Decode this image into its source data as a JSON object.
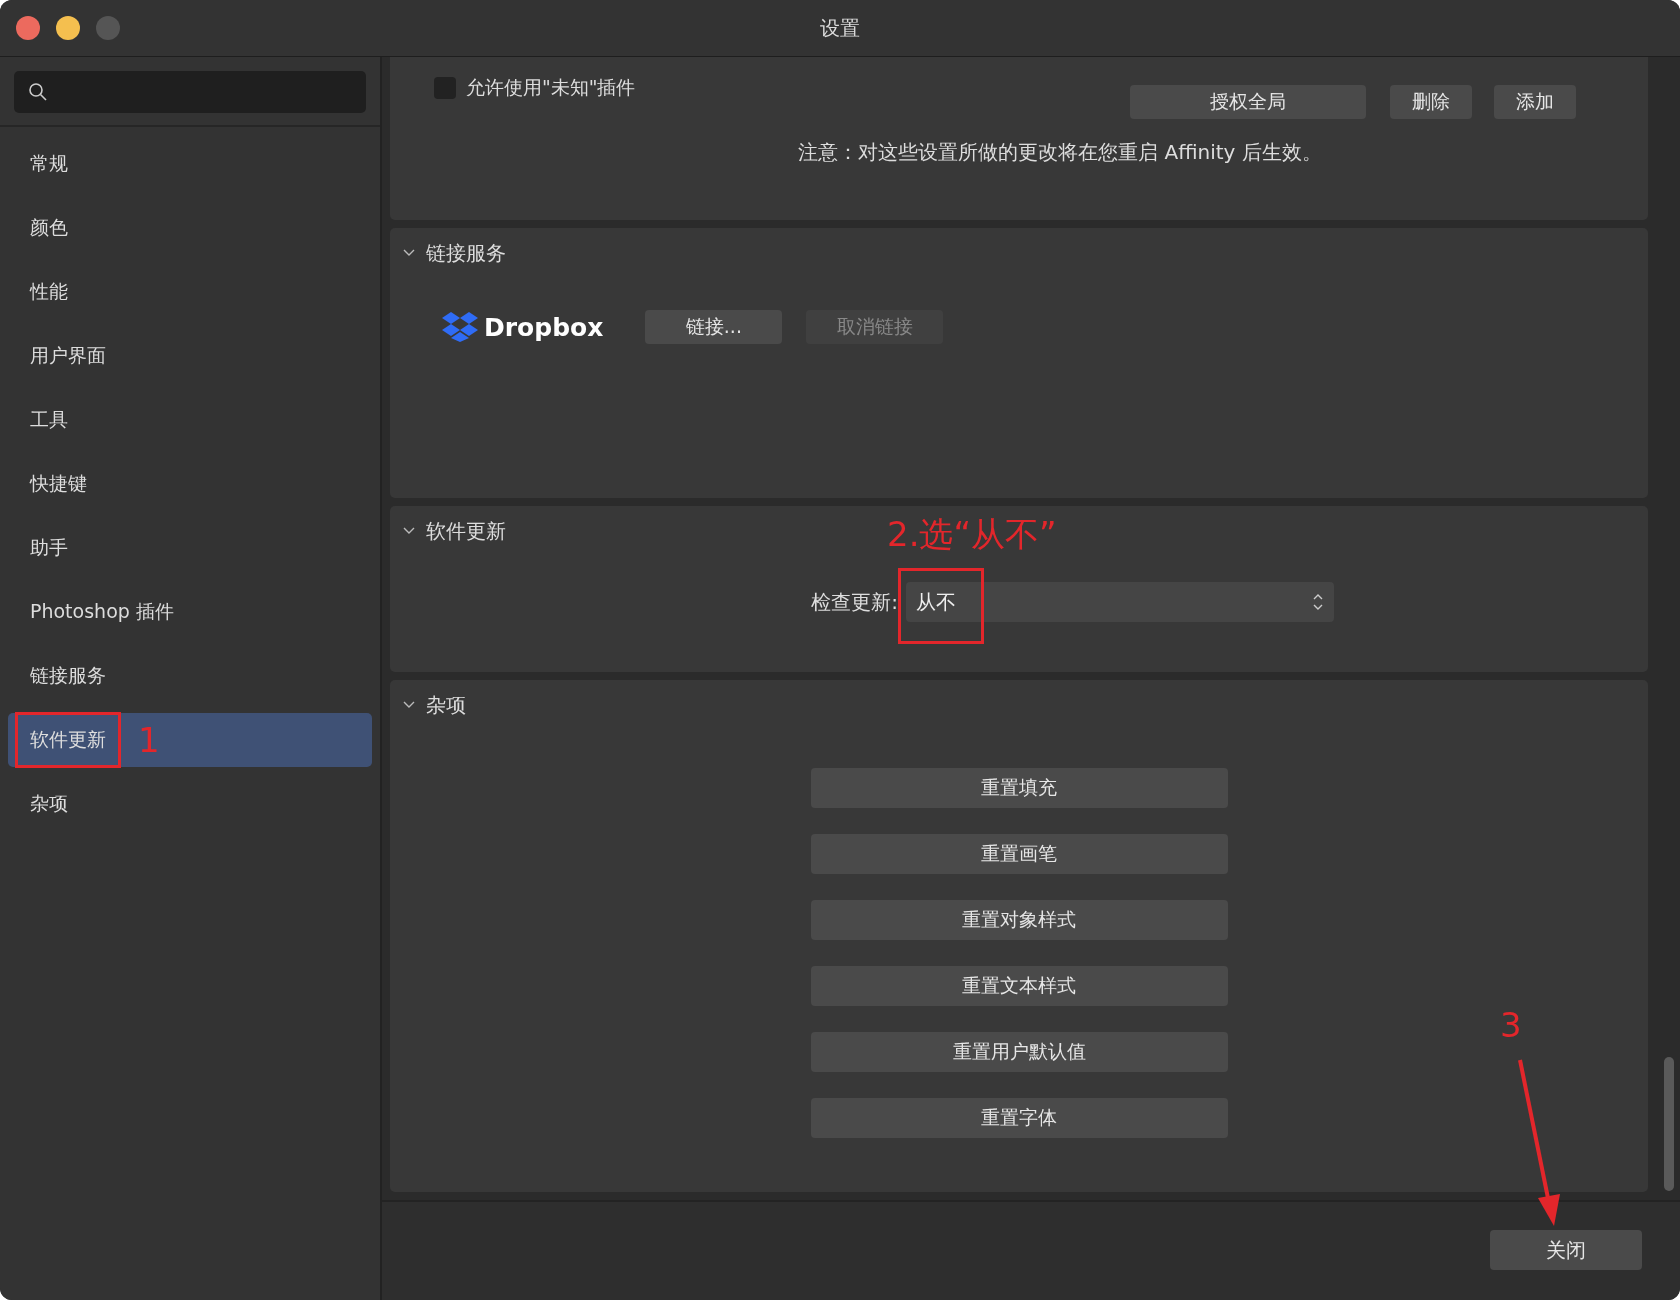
{
  "window": {
    "title": "设置"
  },
  "sidebar": {
    "items": [
      {
        "label": "常规",
        "selected": false
      },
      {
        "label": "颜色",
        "selected": false
      },
      {
        "label": "性能",
        "selected": false
      },
      {
        "label": "用户界面",
        "selected": false
      },
      {
        "label": "工具",
        "selected": false
      },
      {
        "label": "快捷键",
        "selected": false
      },
      {
        "label": "助手",
        "selected": false
      },
      {
        "label": "Photoshop 插件",
        "selected": false
      },
      {
        "label": "链接服务",
        "selected": false
      },
      {
        "label": "软件更新",
        "selected": true,
        "callout": "1"
      },
      {
        "label": "杂项",
        "selected": false
      }
    ]
  },
  "plugins_section": {
    "checkbox": {
      "label": "允许使用\"未知\"插件",
      "checked": false
    },
    "buttons": [
      "授权全局",
      "删除",
      "添加"
    ],
    "note": "注意：对这些设置所做的更改将在您重启 Affinity 后生效。"
  },
  "linked_services": {
    "title": "链接服务",
    "expanded": true,
    "service": "Dropbox",
    "buttons": [
      {
        "label": "链接...",
        "disabled": false
      },
      {
        "label": "取消链接",
        "disabled": true
      }
    ]
  },
  "software_update": {
    "title": "软件更新",
    "expanded": true,
    "callout": "2.选“从不”",
    "check_label": "检查更新:",
    "check_value": "从不"
  },
  "misc": {
    "title": "杂项",
    "expanded": true,
    "buttons": [
      "重置填充",
      "重置画笔",
      "重置对象样式",
      "重置文本样式",
      "重置用户默认值",
      "重置字体"
    ]
  },
  "footer": {
    "close_button": "关闭",
    "callout": "3"
  }
}
